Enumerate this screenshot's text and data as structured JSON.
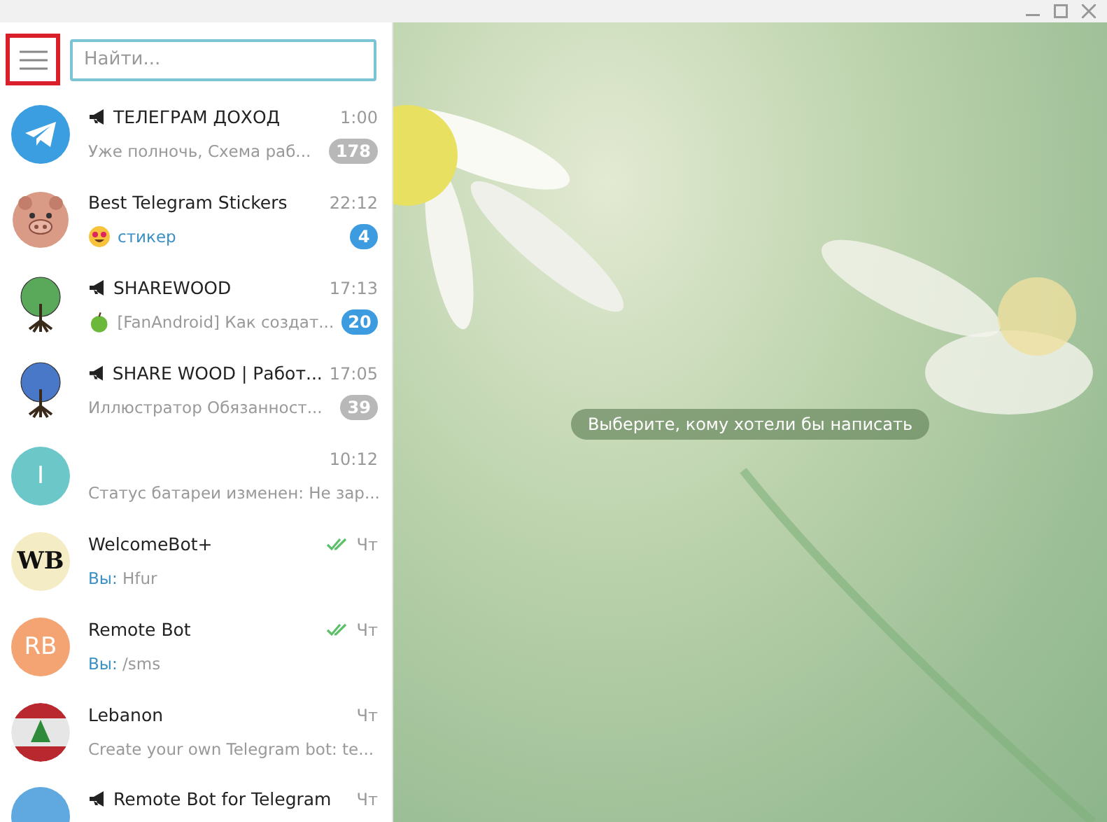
{
  "menu_button": {
    "highlighted": true
  },
  "search": {
    "placeholder": "Найти..."
  },
  "chats": [
    {
      "avatar": {
        "kind": "telegram"
      },
      "channel": true,
      "title": "ТЕЛЕГРАМ ДОХОД",
      "time": "1:00",
      "read": false,
      "media": false,
      "preview": "Уже полночь,  Схема раб...",
      "badge": {
        "count": "178",
        "muted": true
      }
    },
    {
      "avatar": {
        "kind": "pig"
      },
      "channel": false,
      "title": "Best Telegram Stickers",
      "time": "22:12",
      "read": false,
      "preview_icon": {
        "kind": "heart-eyes"
      },
      "media": true,
      "preview": "стикер",
      "badge": {
        "count": "4",
        "muted": false
      }
    },
    {
      "avatar": {
        "kind": "tree",
        "color": "#5aa85a"
      },
      "channel": true,
      "title": "SHAREWOOD",
      "time": "17:13",
      "read": false,
      "preview_icon": {
        "kind": "apple"
      },
      "media": false,
      "preview": "[FanAndroid] Как создат...",
      "badge": {
        "count": "20",
        "muted": false
      }
    },
    {
      "avatar": {
        "kind": "tree",
        "color": "#4a78c8"
      },
      "channel": true,
      "title": "SHARE WOOD | Работ...",
      "time": "17:05",
      "read": false,
      "media": false,
      "preview": "Иллюстратор  Обязанност...",
      "badge": {
        "count": "39",
        "muted": true
      }
    },
    {
      "avatar": {
        "kind": "letters",
        "text": "I",
        "color": "#6cc7c9"
      },
      "channel": false,
      "time": "10:12",
      "read": false,
      "media": false,
      "preview": "Статус батареи изменен: Не зар..."
    },
    {
      "avatar": {
        "kind": "serif",
        "text": "WB",
        "color": "#f3ecc4"
      },
      "channel": false,
      "title": "WelcomeBot+",
      "time": "Чт",
      "read": true,
      "media": false,
      "sender": "Вы:",
      "preview": "Hfur"
    },
    {
      "avatar": {
        "kind": "letters",
        "text": "RB",
        "color": "#f4a373"
      },
      "channel": false,
      "title": "Remote Bot",
      "time": "Чт",
      "read": true,
      "media": false,
      "sender": "Вы:",
      "preview": "/sms"
    },
    {
      "avatar": {
        "kind": "flag"
      },
      "channel": false,
      "title": "Lebanon",
      "time": "Чт",
      "read": false,
      "media": false,
      "preview": "Create your own Telegram bot: te..."
    },
    {
      "avatar": {
        "kind": "letters",
        "color": "#5fa8e0"
      },
      "channel": true,
      "title": "Remote Bot for Telegram",
      "time": "Чт",
      "read": false
    }
  ],
  "empty_state": {
    "text": "Выберите, кому хотели бы написать"
  }
}
